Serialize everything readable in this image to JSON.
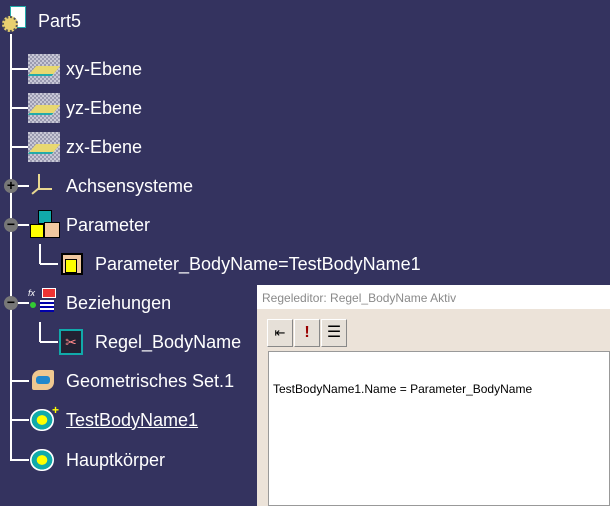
{
  "tree": {
    "root": "Part5",
    "items": [
      {
        "label": "xy-Ebene",
        "icon": "plane-icon"
      },
      {
        "label": "yz-Ebene",
        "icon": "plane-icon"
      },
      {
        "label": "zx-Ebene",
        "icon": "plane-icon"
      },
      {
        "label": "Achsensysteme",
        "icon": "axis-system-icon",
        "expander": "+"
      },
      {
        "label": "Parameter",
        "icon": "parameters-icon",
        "expander": "−"
      },
      {
        "label": "Parameter_BodyName=TestBodyName1",
        "icon": "parameter-icon"
      },
      {
        "label": "Beziehungen",
        "icon": "relations-icon",
        "expander": "−"
      },
      {
        "label": "Regel_BodyName",
        "icon": "rule-icon"
      },
      {
        "label": "Geometrisches Set.1",
        "icon": "geometrical-set-icon"
      },
      {
        "label": "TestBodyName1",
        "icon": "body-icon"
      },
      {
        "label": "Hauptkörper",
        "icon": "body-icon"
      }
    ]
  },
  "dialog": {
    "title": "Regeleditor: Regel_BodyName Aktiv",
    "rule_text": "TestBodyName1.Name = Parameter_BodyName",
    "toolbar": [
      "insert-icon",
      "exclamation-icon",
      "indent-icon"
    ]
  },
  "colors": {
    "background": "#34335f",
    "dialog": "#ece3d9"
  }
}
